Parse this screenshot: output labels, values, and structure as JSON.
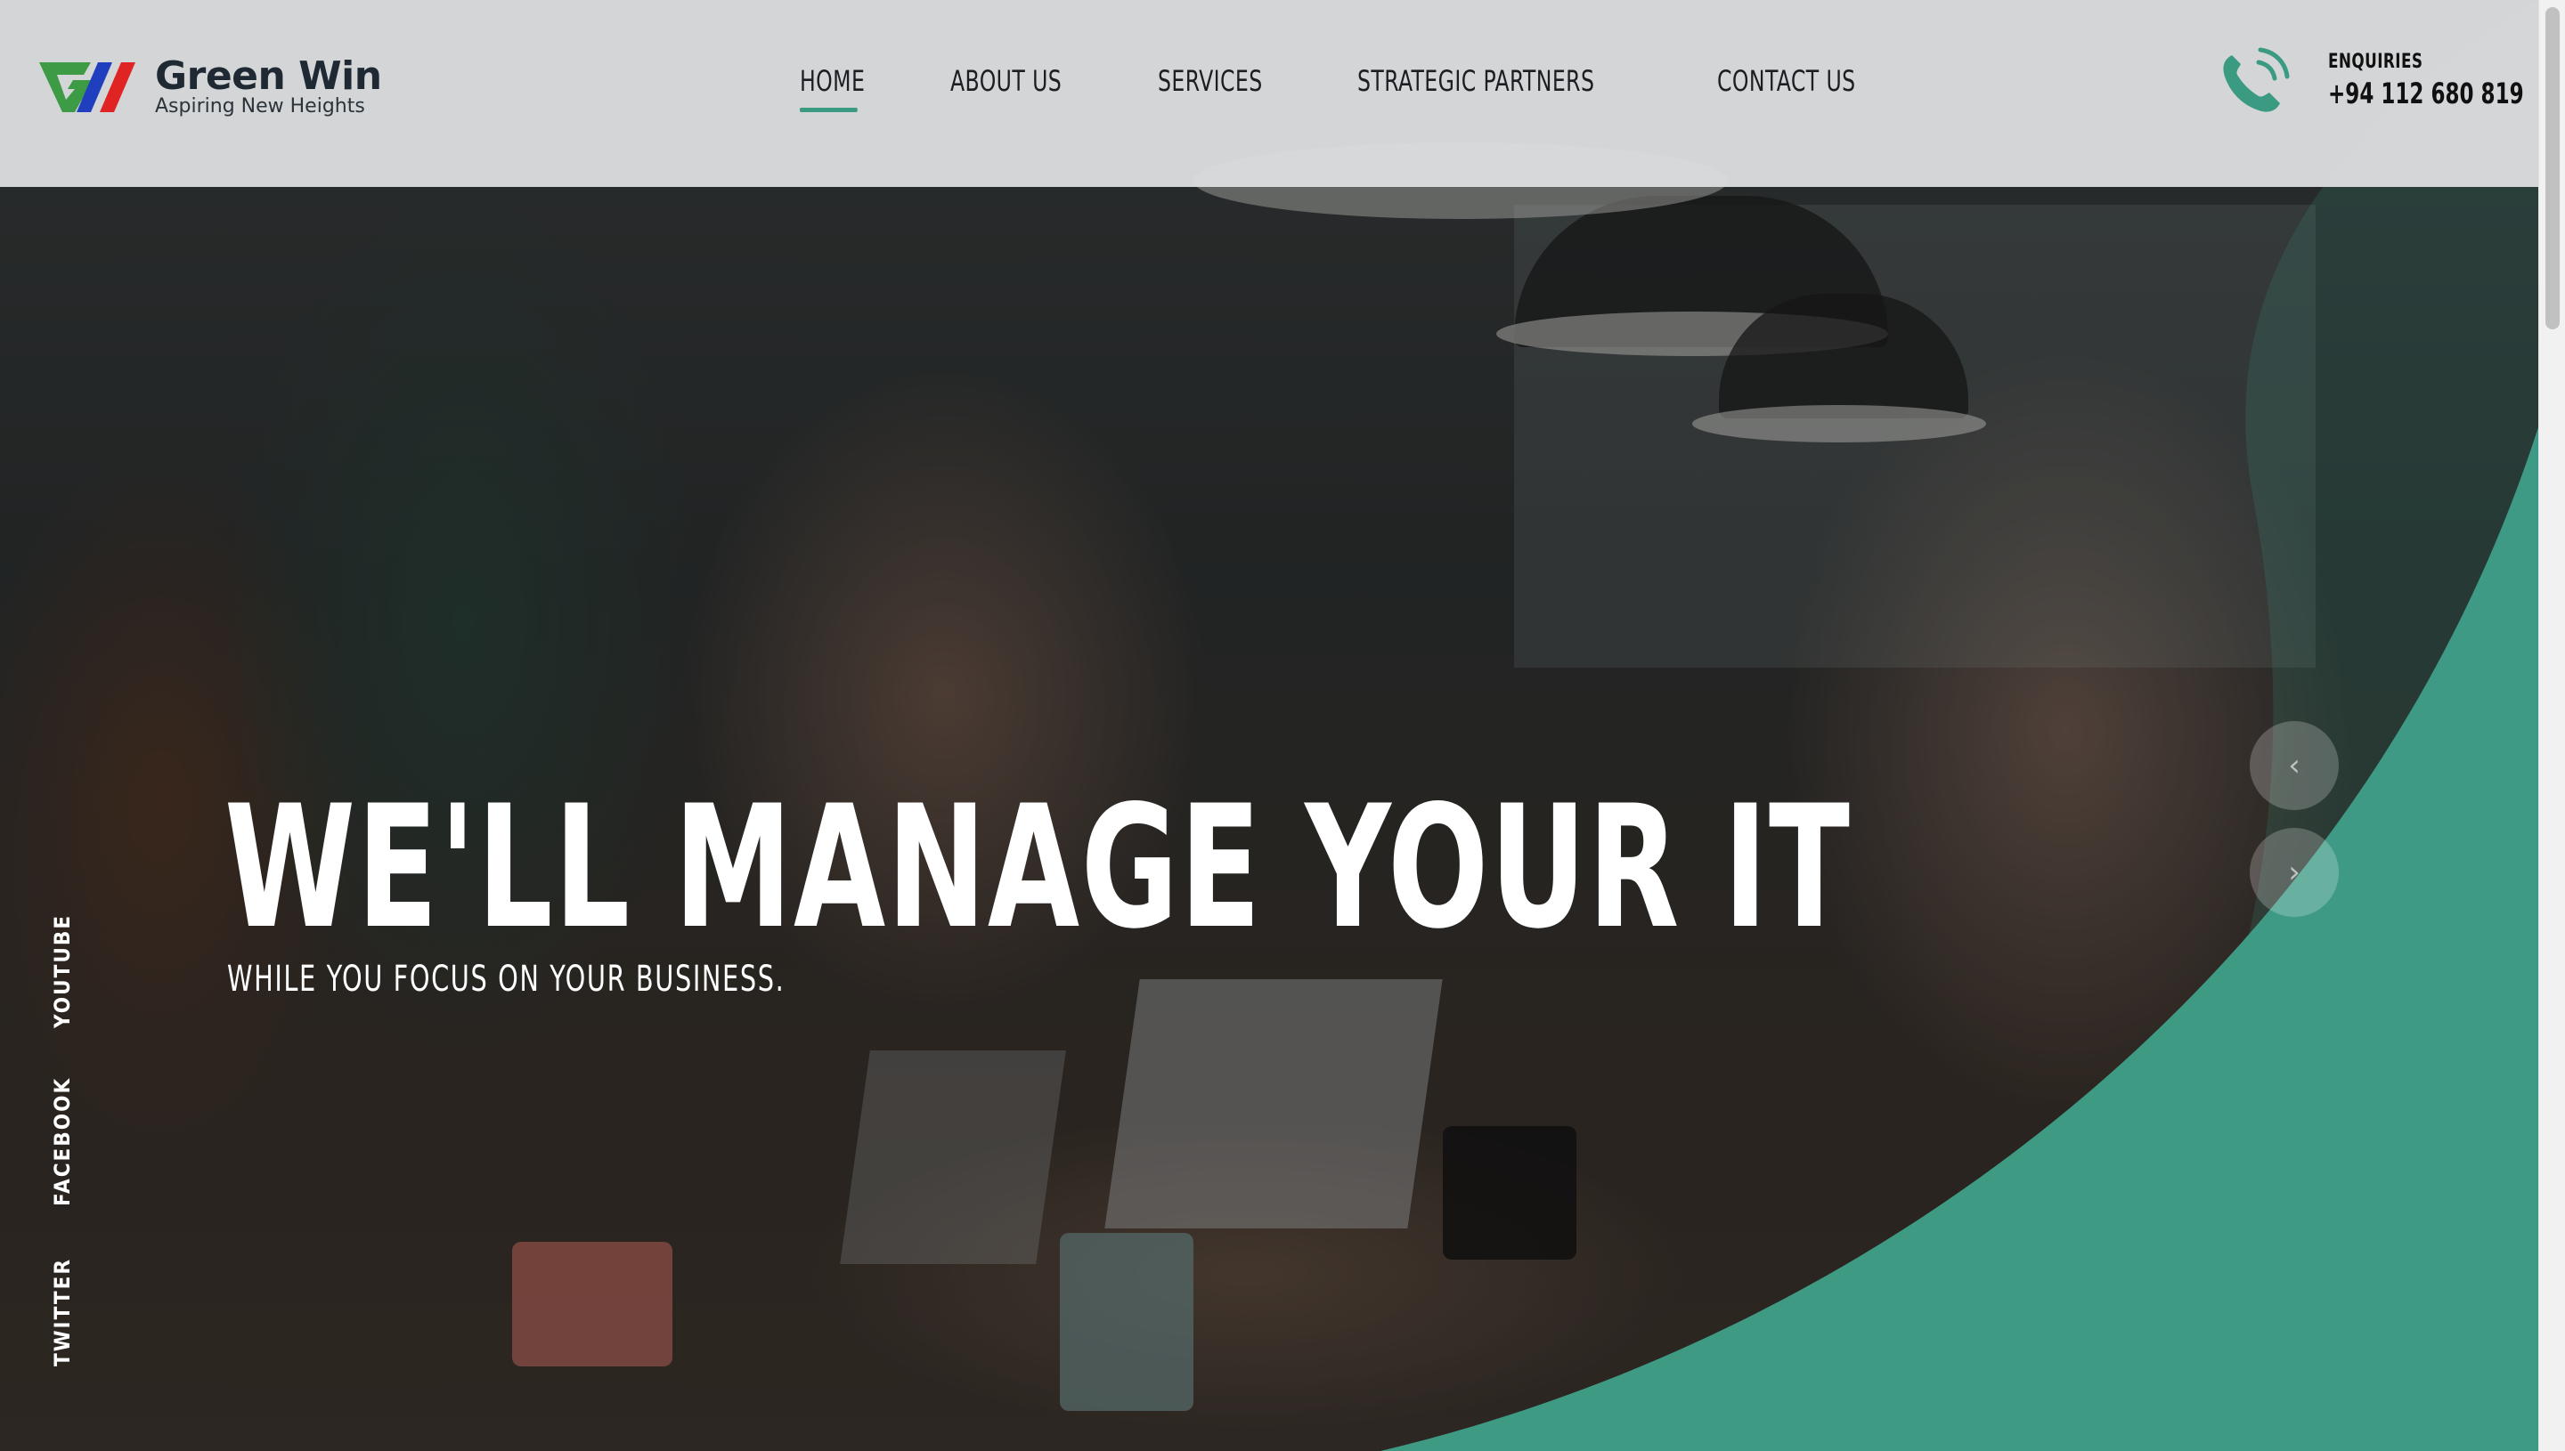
{
  "brand": {
    "name": "Green Win",
    "tagline": "Aspiring New Heights",
    "colors": {
      "accent": "#3a9a82",
      "logo_green": "#3d9a45",
      "logo_blue": "#1f3fbf",
      "logo_red": "#e02424"
    }
  },
  "nav": {
    "items": [
      {
        "label": "HOME",
        "active": true
      },
      {
        "label": "ABOUT US",
        "active": false
      },
      {
        "label": "SERVICES",
        "active": false
      },
      {
        "label": "STRATEGIC PARTNERS",
        "active": false
      },
      {
        "label": "CONTACT US",
        "active": false
      }
    ]
  },
  "enquiry": {
    "label": "ENQUIRIES",
    "phone": "+94 112 680 819",
    "icon": "phone-icon"
  },
  "hero": {
    "title": "WE'LL MANAGE YOUR IT",
    "subtitle": "WHILE YOU FOCUS ON YOUR BUSINESS."
  },
  "social": {
    "links": [
      "YOUTUBE",
      "FACEBOOK",
      "TWITTER"
    ]
  },
  "slider": {
    "prev_icon": "chevron-left-icon",
    "next_icon": "chevron-right-icon",
    "prev_glyph": "‹",
    "next_glyph": "›"
  }
}
